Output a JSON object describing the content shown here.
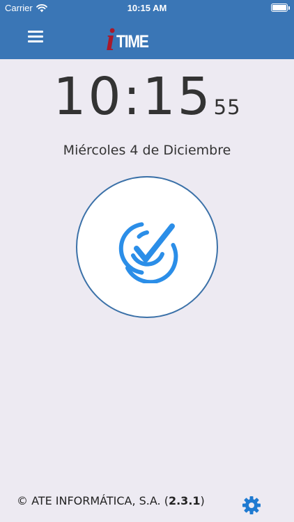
{
  "status_bar": {
    "carrier": "Carrier",
    "time": "10:15 AM",
    "battery_level": 1.0,
    "icons": [
      "wifi-icon",
      "battery-icon"
    ]
  },
  "nav": {
    "menu_icon": "hamburger-menu-icon",
    "logo_i": "i",
    "logo_rest": "TIME"
  },
  "clock": {
    "hours_minutes": "10:15",
    "seconds": "55",
    "date": "Miércoles 4 de Diciembre"
  },
  "punch_button": {
    "icon": "check-target-icon"
  },
  "footer": {
    "copyright_prefix": "© ATE INFORMÁTICA, S.A. (",
    "version": "2.3.1",
    "copyright_suffix": ")",
    "settings_icon": "gear-icon"
  },
  "colors": {
    "header": "#3a76b6",
    "background": "#edeaf2",
    "logo_i": "#a8192b",
    "accent": "#2b8ee8",
    "circle_border": "#3b71a8",
    "gear": "#1f7ad1"
  }
}
